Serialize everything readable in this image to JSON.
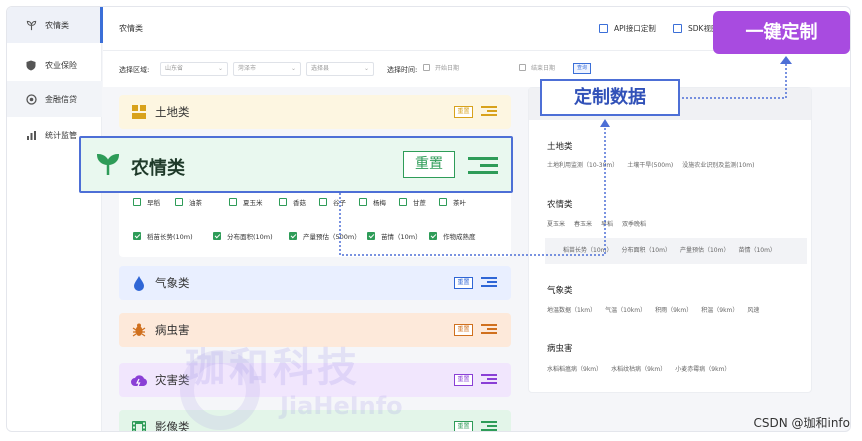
{
  "sidebar": {
    "items": [
      {
        "label": "农情类",
        "icon": "sprout-icon",
        "active": true
      },
      {
        "label": "农业保险",
        "icon": "shield-icon",
        "active": false
      },
      {
        "label": "金融信贷",
        "icon": "coin-icon",
        "active": false
      },
      {
        "label": "统计监管",
        "icon": "bar-chart-icon",
        "active": false
      }
    ]
  },
  "header": {
    "title": "农情类",
    "api_label": "API接口定制",
    "sdk_label": "SDK视图"
  },
  "filters": {
    "region_label": "选择区域:",
    "province": "山东省",
    "city": "菏泽市",
    "county": "选择县",
    "time_label": "选择时间:",
    "start_date": "开始日期",
    "end_date": "结束日期",
    "query_button": "查询"
  },
  "categories": [
    {
      "label": "土地类",
      "reset": "重置",
      "color": "#d8a21c",
      "bg": "#fdf6e1",
      "icon": "blocks-icon"
    },
    {
      "label": "气象类",
      "reset": "重置",
      "color": "#2f66d6",
      "bg": "#e9efff",
      "icon": "droplet-icon"
    },
    {
      "label": "病虫害",
      "reset": "重置",
      "color": "#d0701e",
      "bg": "#fde9da",
      "icon": "bug-icon"
    },
    {
      "label": "灾害类",
      "reset": "重置",
      "color": "#8a3fd6",
      "bg": "#f1e6fd",
      "icon": "storm-cloud-icon"
    },
    {
      "label": "影像类",
      "reset": "重置",
      "color": "#2e9c58",
      "bg": "#e3f5e9",
      "icon": "film-icon"
    }
  ],
  "crops": [
    "早稻",
    "油茶",
    "夏玉米",
    "香菇",
    "谷子",
    "杨梅",
    "甘蔗",
    "茶叶"
  ],
  "indicators": [
    "稻苗长势(10m)",
    "分布面积(10m)",
    "产量预估（500m）",
    "苗情（10m）",
    "作物成熟度"
  ],
  "overlay_card": {
    "label": "农情类",
    "reset": "重置",
    "color": "#2e9c58"
  },
  "panel": {
    "sections": [
      {
        "title": "土地类",
        "items": [
          "土地利用监测（10-30m）",
          "土壤干旱(500m)",
          "没施农业识别及监测(10m)"
        ]
      },
      {
        "title": "农情类",
        "items": [
          "夏玉米",
          "春玉米",
          "早稻",
          "双季晚稻"
        ]
      },
      {
        "title": "气象类",
        "items": [
          "地温数据（1km）",
          "气温（10km）",
          "积雨（9km）",
          "积温（9km）",
          "风速"
        ]
      },
      {
        "title": "病虫害",
        "items": [
          "水稻稻瘟病（9km）",
          "水稻纹枯病（9km）",
          "小麦赤霉病（9km）"
        ]
      }
    ],
    "selected_strip": [
      "稻苗长势（10m）",
      "分布面积（10m）",
      "产量预估（10m）",
      "苗情（10m）"
    ]
  },
  "callouts": {
    "custom_data": "定制数据",
    "one_key": "一键定制",
    "accent": "#4d6fd6",
    "purple": "#a84be0"
  },
  "watermark": {
    "text": "珈和科技",
    "sub": "JiaHeInfo"
  },
  "footer": {
    "credit": "CSDN @珈和info"
  }
}
